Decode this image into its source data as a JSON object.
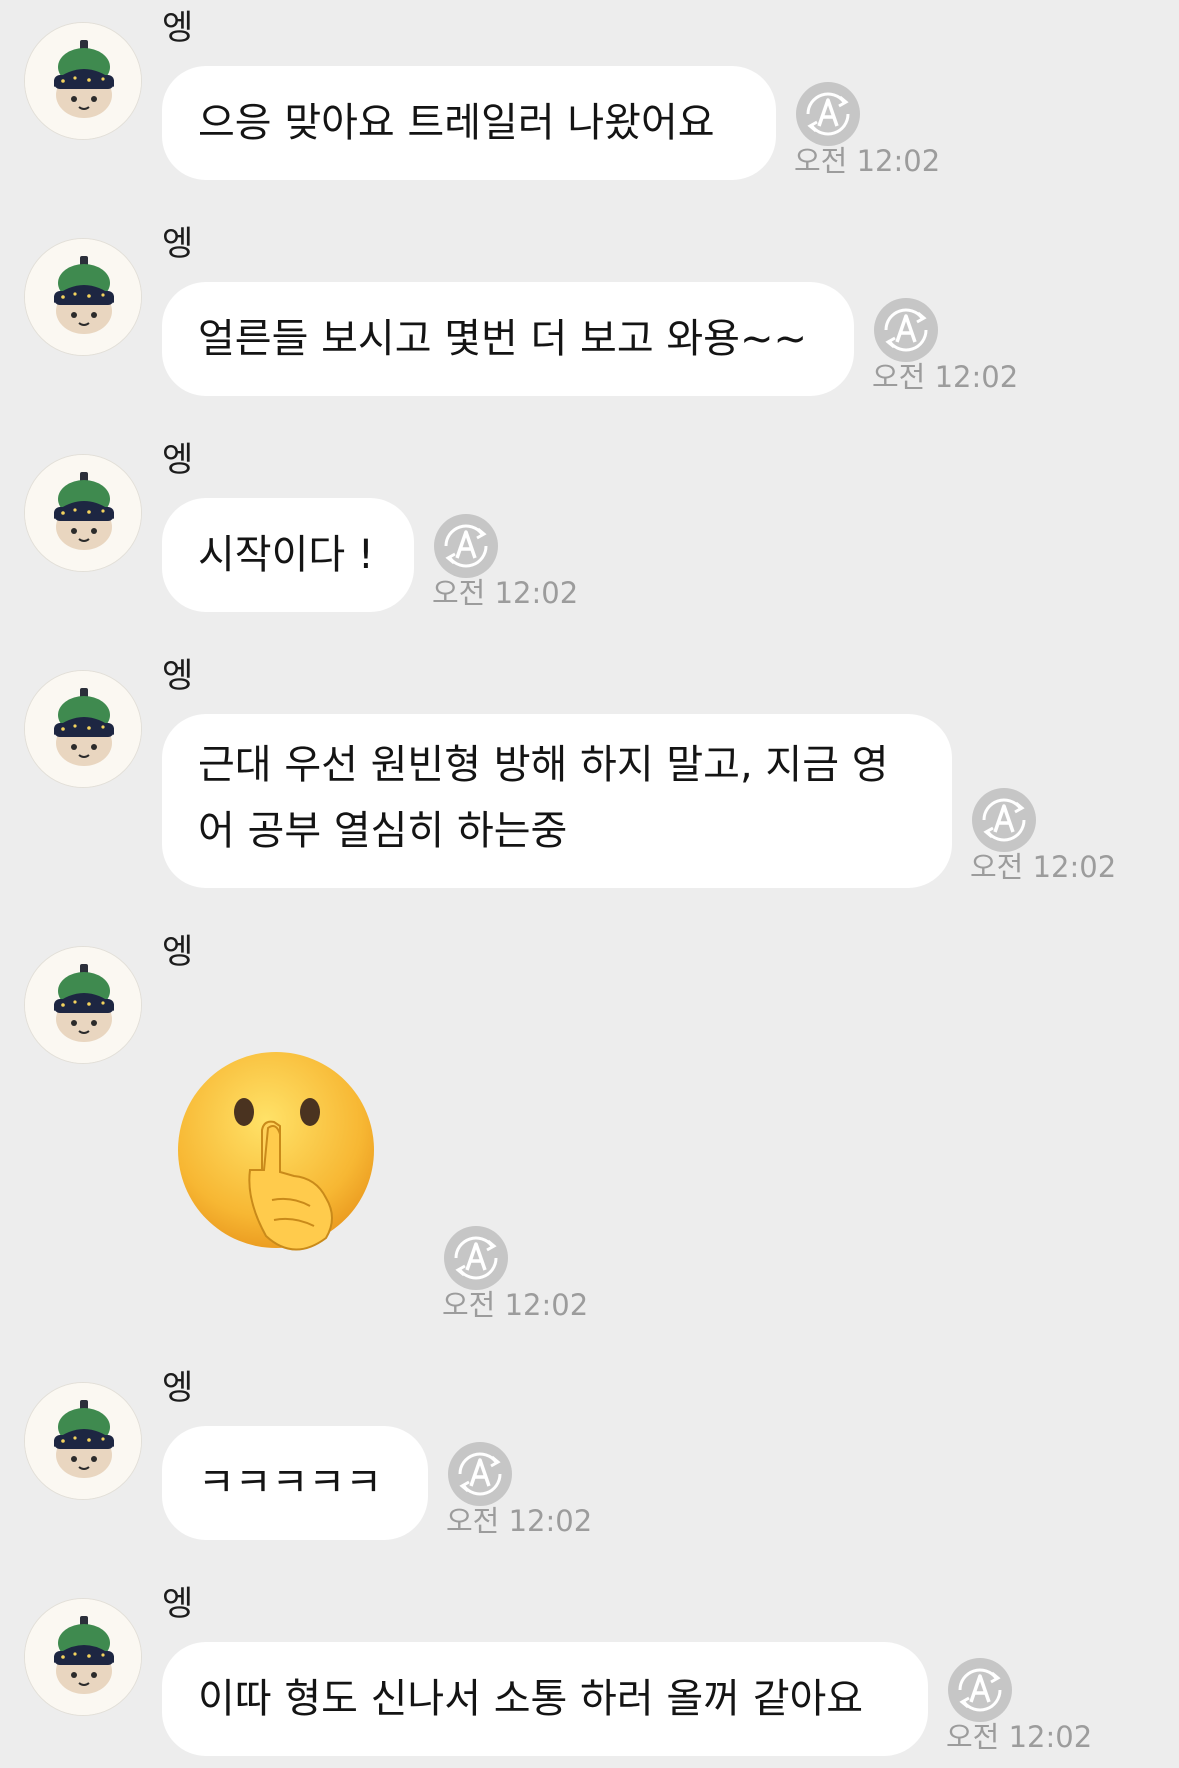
{
  "messages": [
    {
      "sender": "엥",
      "text": "으응 맞아요 트레일러 나왔어요",
      "time": "오전 12:02"
    },
    {
      "sender": "엥",
      "text": "얼른들 보시고 몇번 더 보고 와용~~",
      "time": "오전 12:02"
    },
    {
      "sender": "엥",
      "text": "시작이다 !",
      "time": "오전 12:02"
    },
    {
      "sender": "엥",
      "lines": [
        "근대 우선 원빈형 방해 하지 말고, 지금 영",
        "어 공부 열심히 하는중"
      ],
      "time": "오전 12:02"
    },
    {
      "sender": "엥",
      "emoji": "shushing-face",
      "time": "오전 12:02"
    },
    {
      "sender": "엥",
      "text": "ㅋㅋㅋㅋㅋ",
      "time": "오전 12:02"
    },
    {
      "sender": "엥",
      "text": "이따 형도 신나서 소통 하러 올꺼 같아요",
      "time": "오전 12:02"
    }
  ],
  "icons": {
    "avatar": "plush-character-avatar",
    "translate": "auto-translate-icon",
    "emoji": "shushing-face-emoji"
  },
  "colors": {
    "background": "#ededed",
    "bubble": "#ffffff",
    "time": "#9c9c9c",
    "icon": "#c4c4c4"
  }
}
